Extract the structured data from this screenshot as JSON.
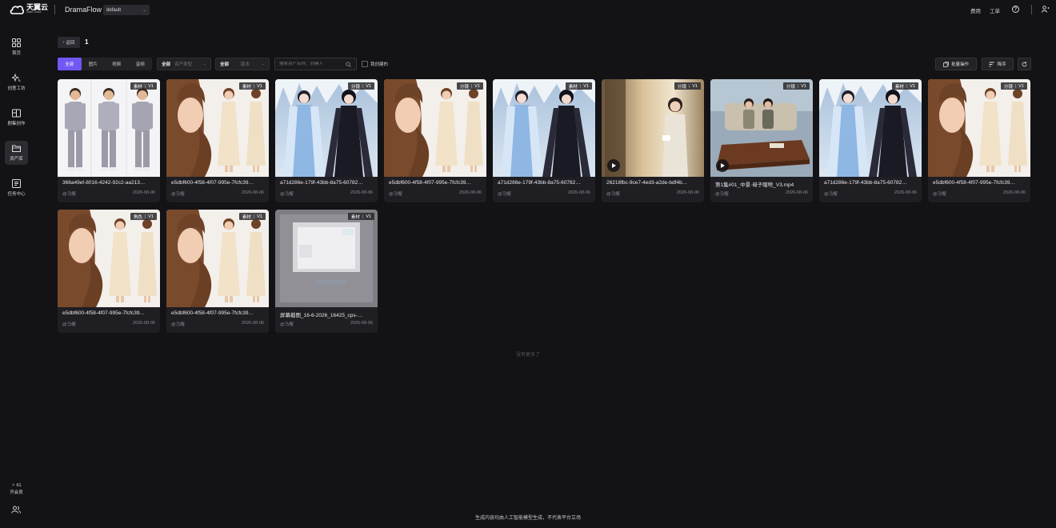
{
  "topbar": {
    "logo_cn": "天翼云",
    "logo_en": "State Cloud",
    "app_name": "DramaFlow",
    "workspace": "default",
    "links": [
      "费用",
      "工单"
    ],
    "help": "?"
  },
  "sidebar": {
    "items": [
      {
        "label": "首页",
        "icon": "grid-icon"
      },
      {
        "label": "创意工坊",
        "icon": "sparkle-icon"
      },
      {
        "label": "剧集创作",
        "icon": "book-icon"
      },
      {
        "label": "资产库",
        "icon": "folder-icon",
        "active": true
      },
      {
        "label": "任务中心",
        "icon": "task-list-icon"
      }
    ],
    "credits_value": "61",
    "credits_label": "开会员"
  },
  "header": {
    "back_label": "返回",
    "title": "1"
  },
  "filters": {
    "types": [
      "全部",
      "图片",
      "视频",
      "音频"
    ],
    "active_type": "全部",
    "category_value": "全部",
    "category_placeholder": "资产类型",
    "version_value": "全部",
    "version_placeholder": "版本",
    "search_placeholder": "搜索资产名称、创建人",
    "mine_label": "我创建的",
    "batch_label": "批量操作",
    "sort_label": "降序"
  },
  "assets": [
    {
      "name": "366a49ef-8016-4242-92c2-aa213…",
      "owner": "@马帽",
      "date": "2026-08-06",
      "tag": "素材",
      "version": "V1",
      "art": "man",
      "video": false
    },
    {
      "name": "e5dbf600-4f58-4f07-995e-7fcfc39…",
      "owner": "@马帽",
      "date": "2026-08-06",
      "tag": "素材",
      "version": "V1",
      "art": "woman",
      "video": false
    },
    {
      "name": "a71d286e-179f-43bb-8a75-60782…",
      "owner": "@马帽",
      "date": "2026-08-06",
      "tag": "分镜",
      "version": "V1",
      "art": "ice",
      "video": false
    },
    {
      "name": "e5dbf600-4f58-4f07-995e-7fcfc39…",
      "owner": "@马帽",
      "date": "2026-08-06",
      "tag": "分镜",
      "version": "V1",
      "art": "woman",
      "video": false
    },
    {
      "name": "a71d286e-179f-43bb-8a75-60782…",
      "owner": "@马帽",
      "date": "2026-08-06",
      "tag": "素材",
      "version": "V1",
      "art": "ice",
      "video": false
    },
    {
      "name": "26218fbc-9ce7-4ed3-a2de-bdf4b…",
      "owner": "@马帽",
      "date": "2026-08-06",
      "tag": "分镜",
      "version": "V1",
      "art": "room",
      "video": true
    },
    {
      "name": "第1集#01_中景·母子瞎啥_V3.mp4",
      "owner": "@马帽",
      "date": "2026-08-06",
      "tag": "分镜",
      "version": "V1",
      "art": "living",
      "video": true
    },
    {
      "name": "a71d286e-179f-43bb-8a75-60782…",
      "owner": "@马帽",
      "date": "2026-08-06",
      "tag": "素材",
      "version": "V1",
      "art": "ice",
      "video": false
    },
    {
      "name": "e5dbf600-4f58-4f07-995e-7fcfc39…",
      "owner": "@马帽",
      "date": "2026-08-06",
      "tag": "分镜",
      "version": "V1",
      "art": "woman",
      "video": false
    },
    {
      "name": "e5dbf600-4f58-4f07-995e-7fcfc39…",
      "owner": "@马帽",
      "date": "2026-08-06",
      "tag": "角色",
      "version": "V1",
      "art": "woman",
      "video": false
    },
    {
      "name": "e5dbf600-4f58-4f07-995e-7fcfc39…",
      "owner": "@马帽",
      "date": "2026-08-06",
      "tag": "素材",
      "version": "V1",
      "art": "woman",
      "video": false
    },
    {
      "name": "屏幕截图_16-6-2026_16425_cps-…",
      "owner": "@马帽",
      "date": "2026-08-06",
      "tag": "素材",
      "version": "V1",
      "art": "blur",
      "video": false
    }
  ],
  "end_note": "没有更多了",
  "footer_note": "生成内容均由人工智能模型生成，不代表平台立场",
  "colors": {
    "accent": "#7158f5",
    "background": "#131316",
    "card": "#1e1e23"
  }
}
